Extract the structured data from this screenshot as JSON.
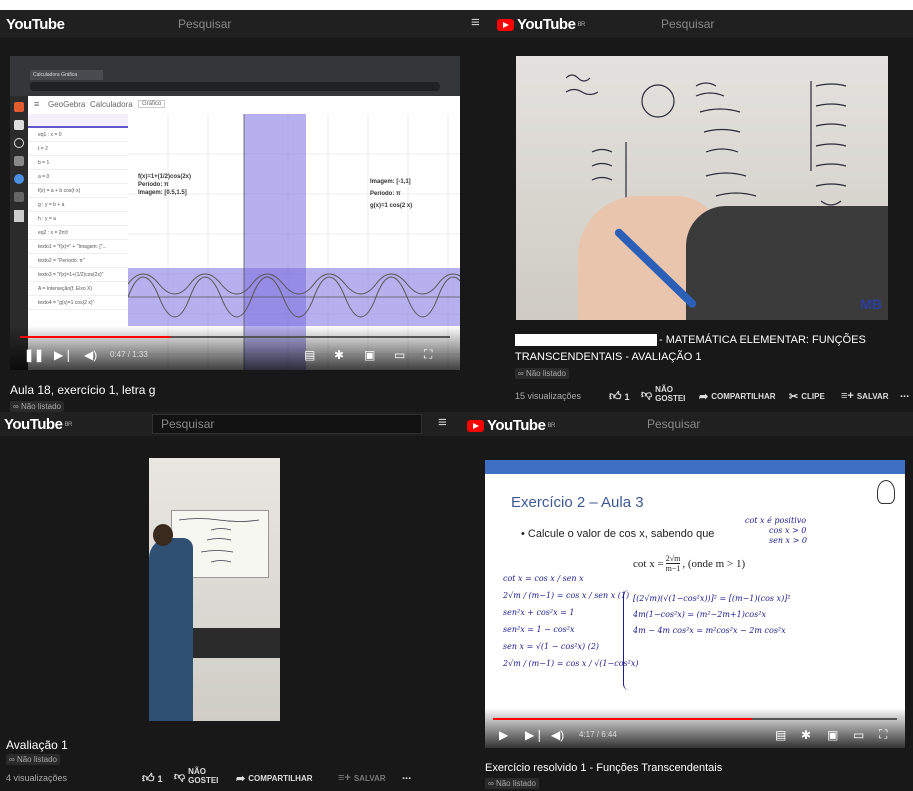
{
  "p1": {
    "logo": "YouTube",
    "region": "BR",
    "search": "Pesquisar",
    "browser": {
      "tab_title": "Calculadora Gráfica",
      "sidebar_brand": "GeoGebra",
      "app_name": "Calculadora",
      "tool": "Gráfico"
    },
    "gg": {
      "eqs": [
        "eq1 : x = 0",
        "t = 2",
        "b = 1",
        "a = 0",
        "f(x) = a + b cos(t·x)",
        "g : y = b + a",
        "h : y = a",
        "eq2 : x = 2π/t",
        "texto1 = \"f(x)=\" + \"Imagem: [\"...",
        "texto2 = \"Período: π\"",
        "texto3 = \"f(x)=1+(1/2)cos(2x)\"",
        "A = Interseção(f, Eixo X)",
        "texto4 = \"g(x)=1 cos(2 x)\""
      ],
      "left_label": [
        "f(x)=1+(1/2)cos(2x)",
        "Período: π",
        "Imagem: [0.5,1.5]"
      ],
      "right_label": [
        "Imagem: [-1,1]",
        "Período: π",
        "g(x)=1 cos(2 x)"
      ]
    },
    "time": "0:47 / 1:33",
    "progress": 0.35,
    "title": "Aula 18, exercício 1, letra g",
    "unlisted": "Não listado"
  },
  "p2": {
    "logo": "YouTube",
    "region": "BR",
    "search": "Pesquisar",
    "watermark": "MB",
    "title_line1": "- MATEMÁTICA ELEMENTAR: FUNÇÕES",
    "title_line2": "TRANSCENDENTAIS - AVALIAÇÃO 1",
    "unlisted": "Não listado",
    "views": "15 visualizações",
    "likes": "1",
    "dislike": "NÃO GOSTEI",
    "share": "COMPARTILHAR",
    "clip": "CLIPE",
    "save": "SALVAR",
    "more": "...",
    "progress": 0.0
  },
  "p3": {
    "logo": "YouTube",
    "region": "BR",
    "search": "Pesquisar",
    "title": "Avaliação 1",
    "unlisted": "Não listado",
    "views": "4 visualizações",
    "likes": "1",
    "dislike": "NÃO GOSTEI",
    "share": "COMPARTILHAR",
    "save": "SALVAR",
    "more": "..."
  },
  "p4": {
    "logo": "YouTube",
    "region": "BR",
    "search": "Pesquisar",
    "slide_title": "Exercício 2 – Aula 3",
    "bullet": "Calcule o valor de cos x, sabendo que",
    "formula_lhs": "cot x = ",
    "formula_num": "2√m",
    "formula_den": "m−1",
    "formula_rhs": ", (onde m > 1)",
    "hand_notes": [
      "cot x = cos x / sen x",
      "2√m / (m−1) = cos x / sen x  (1)",
      "sen²x + cos²x = 1",
      "sen²x = 1 − cos²x",
      "sen x = √(1 − cos²x)  (2)",
      "2√m / (m−1) = cos x / √(1−cos²x)"
    ],
    "hand_notes_right": [
      "cot x é positivo",
      "cos x > 0",
      "sen x > 0",
      "[(2√m)(√(1−cos²x))]² = [(m−1)(cos x)]²",
      "4m(1−cos²x) = (m²−2m+1)cos²x",
      "4m − 4m cos²x = m²cos²x − 2m cos²x"
    ],
    "time": "4:17 / 6:44",
    "progress": 0.64,
    "title": "Exercício resolvido 1 - Funções Transcendentais",
    "unlisted": "Não listado"
  },
  "colors": {
    "accent": "#ff0000",
    "bg": "#181818",
    "bar": "#202020"
  }
}
